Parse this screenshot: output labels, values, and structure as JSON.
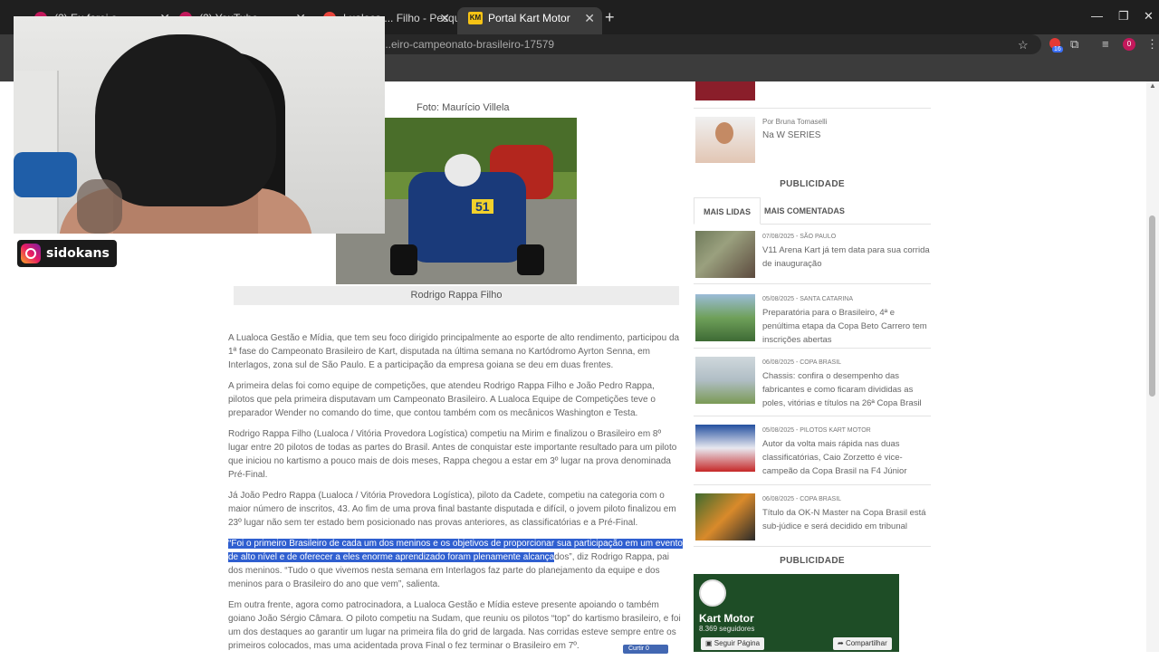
{
  "browser": {
    "tabs": [
      {
        "title": "(2) Eu farei o ...",
        "active": false
      },
      {
        "title": "(2) YouTube",
        "active": false
      },
      {
        "title": "Lualoca ... Filho - Pesquisa G",
        "active": false
      },
      {
        "title": "Portal Kart Motor",
        "active": true,
        "icon": "KM"
      }
    ],
    "url": "...eiro-campeonato-brasileiro-17579",
    "extension_count": "16",
    "profile_initial": "0"
  },
  "streamer": {
    "handle": "sidokans"
  },
  "article": {
    "photo_credit": "Foto: Maurício Villela",
    "photo_kart_number": "51",
    "caption": "Rodrigo Rappa Filho",
    "paragraphs": [
      "A Lualoca Gestão e Mídia, que tem seu foco dirigido principalmente ao esporte de alto rendimento, participou da 1ª fase do Campeonato Brasileiro de Kart, disputada na última semana no Kartódromo Ayrton Senna, em Interlagos, zona sul de São Paulo. E a participação da empresa goiana se deu em duas frentes.",
      "A primeira delas foi como equipe de competições, que atendeu Rodrigo Rappa Filho e João Pedro Rappa, pilotos que pela primeira disputavam um Campeonato Brasileiro. A Lualoca Equipe de Competições teve o preparador Wender no comando do time, que contou também com os mecânicos Washington e Testa.",
      "Rodrigo Rappa Filho (Lualoca / Vitória Provedora Logística) competiu na Mirim e finalizou o Brasileiro em 8º lugar entre 20 pilotos de todas as partes do Brasil. Antes de conquistar este importante resultado para um piloto que iniciou no kartismo a pouco mais de dois meses, Rappa chegou a estar em 3º lugar na prova denominada Pré-Final.",
      "Já João Pedro Rappa (Lualoca / Vitória Provedora Logística), piloto da Cadete, competiu na categoria com o maior número de inscritos, 43. Ao fim de uma prova final bastante disputada e difícil, o jovem piloto finalizou em 23º lugar não sem ter estado bem posicionado nas provas anteriores, as classificatórias e a Pré-Final."
    ],
    "quote_highlighted": "“Foi o primeiro Brasileiro de cada um dos meninos e os objetivos de proporcionar sua participação em um evento de alto nível e de oferecer a eles enorme aprendizado foram plenamente alcança",
    "quote_rest": "dos”, diz Rodrigo Rappa, pai dos meninos. “Tudo o que vivemos nesta semana em Interlagos faz parte do planejamento da equipe e dos meninos para o Brasileiro do ano que vem”, salienta.",
    "last_paragraph": "Em outra frente, agora como patrocinadora, a Lualoca Gestão e Mídia esteve presente apoiando o também goiano João Sérgio Câmara. O piloto competiu na Sudam, que reuniu os pilotos “top” do kartismo brasileiro, e foi um dos destaques ao garantir um lugar na primeira fila do grid de largada. Nas corridas esteve sempre entre os primeiros colocados, mas uma acidentada prova Final o fez terminar o Brasileiro em 7º.",
    "fb_like": "Curtir 0"
  },
  "sidebar": {
    "author_by": "Por Bruna Tomaselli",
    "author_title": "Na W SERIES",
    "publicidade_1": "PUBLICIDADE",
    "tabs": [
      "MAIS LIDAS",
      "MAIS COMENTADAS"
    ],
    "news": [
      {
        "meta": "07/08/2025 - SÃO PAULO",
        "title": "V11 Arena Kart já tem data para sua corrida de inauguração"
      },
      {
        "meta": "05/08/2025 - SANTA CATARINA",
        "title": "Preparatória para o Brasileiro, 4ª e penúltima etapa da Copa Beto Carrero tem inscrições abertas"
      },
      {
        "meta": "06/08/2025 - COPA BRASIL",
        "title": "Chassis: confira o desempenho das fabricantes e como ficaram divididas as poles, vitórias e títulos na 26ª Copa Brasil"
      },
      {
        "meta": "05/08/2025 - PILOTOS KART MOTOR",
        "title": "Autor da volta mais rápida nas duas classificatórias, Caio Zorzetto é vice-campeão da Copa Brasil na F4 Júnior"
      },
      {
        "meta": "06/08/2025 - COPA BRASIL",
        "title": "Título da OK-N Master na Copa Brasil está sub-júdice e será decidido em tribunal"
      }
    ],
    "publicidade_2": "PUBLICIDADE",
    "fb": {
      "name": "Kart Motor",
      "followers": "8.369 seguidores",
      "follow": "Seguir Página",
      "share": "Compartilhar"
    }
  }
}
